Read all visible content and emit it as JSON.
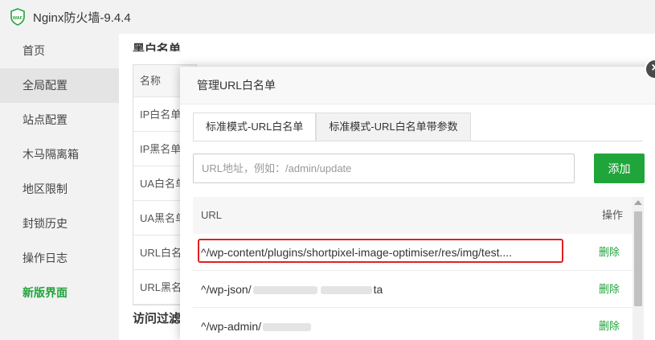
{
  "app": {
    "title": "Nginx防火墙-9.4.4",
    "logo_text": "WAF"
  },
  "sidebar": {
    "items": [
      {
        "label": "首页"
      },
      {
        "label": "全局配置"
      },
      {
        "label": "站点配置"
      },
      {
        "label": "木马隔离箱"
      },
      {
        "label": "地区限制"
      },
      {
        "label": "封锁历史"
      },
      {
        "label": "操作日志"
      },
      {
        "label": "新版界面"
      }
    ]
  },
  "background": {
    "section_title": "黑白名单",
    "table_header": "名称",
    "rows": [
      "IP白名单",
      "IP黑名单",
      "UA白名单",
      "UA黑名单",
      "URL白名单",
      "URL黑名单"
    ],
    "section2_title": "访问过滤"
  },
  "modal": {
    "title": "管理URL白名单",
    "close_symbol": "×",
    "tabs": [
      {
        "label": "标准模式-URL白名单"
      },
      {
        "label": "标准模式-URL白名单带参数"
      }
    ],
    "input_placeholder": "URL地址，例如：/admin/update",
    "add_label": "添加",
    "table": {
      "col_url": "URL",
      "col_action": "操作",
      "rows": [
        {
          "url": "^/wp-content/plugins/shortpixel-image-optimiser/res/img/test....",
          "action": "删除"
        },
        {
          "url": "^/wp-json/",
          "url_tail": "ta",
          "action": "删除"
        },
        {
          "url": "^/wp-admin/",
          "action": "删除"
        }
      ]
    }
  },
  "colors": {
    "accent": "#20a53a",
    "highlight": "#e02020"
  }
}
